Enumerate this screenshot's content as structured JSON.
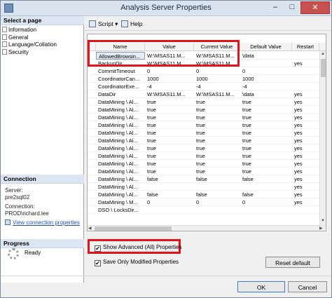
{
  "window": {
    "title": "Analysis Server Properties"
  },
  "sidebar": {
    "select_page_heading": "Select a page",
    "pages": [
      "Information",
      "General",
      "Language/Collation",
      "Security"
    ],
    "connection_heading": "Connection",
    "server_label": "Server:",
    "server_value": "pre2sql02",
    "connection_label": "Connection:",
    "connection_value": "PROD\\richard.lee",
    "view_connection_link": "View connection properties",
    "progress_heading": "Progress",
    "progress_status": "Ready"
  },
  "toolbar": {
    "script_label": "Script",
    "help_label": "Help"
  },
  "grid": {
    "headers": [
      "Name",
      "Value",
      "Current Value",
      "Default Value",
      "Restart"
    ],
    "rows": [
      [
        "AllowedBrowsin...",
        "W:\\MSAS11.M...",
        "W:\\MSAS11.M...",
        "\\data",
        ""
      ],
      [
        "BackupDir",
        "W:\\MSAS11.M...",
        "W:\\MSAS11.M...",
        "",
        "yes"
      ],
      [
        "CommitTimeout",
        "0",
        "0",
        "0",
        ""
      ],
      [
        "CoordinatorCan...",
        "1000",
        "1000",
        "1000",
        ""
      ],
      [
        "CoordinatorExe...",
        "-4",
        "-4",
        "-4",
        ""
      ],
      [
        "DataDir",
        "W:\\MSAS11.M...",
        "W:\\MSAS11.M...",
        "\\data",
        "yes"
      ],
      [
        "DataMining \\ Al...",
        "true",
        "true",
        "true",
        "yes"
      ],
      [
        "DataMining \\ Al...",
        "true",
        "true",
        "true",
        "yes"
      ],
      [
        "DataMining \\ Al...",
        "true",
        "true",
        "true",
        "yes"
      ],
      [
        "DataMining \\ Al...",
        "true",
        "true",
        "true",
        "yes"
      ],
      [
        "DataMining \\ Al...",
        "true",
        "true",
        "true",
        "yes"
      ],
      [
        "DataMining \\ Al...",
        "true",
        "true",
        "true",
        "yes"
      ],
      [
        "DataMining \\ Al...",
        "true",
        "true",
        "true",
        "yes"
      ],
      [
        "DataMining \\ Al...",
        "true",
        "true",
        "true",
        "yes"
      ],
      [
        "DataMining \\ Al...",
        "true",
        "true",
        "true",
        "yes"
      ],
      [
        "DataMining \\ Al...",
        "true",
        "true",
        "true",
        "yes"
      ],
      [
        "DataMining \\ Al...",
        "false",
        "false",
        "false",
        "yes"
      ],
      [
        "DataMining \\ Al...",
        "",
        "",
        "",
        "yes"
      ],
      [
        "DataMining \\ Al...",
        "false",
        "false",
        "false",
        "yes"
      ],
      [
        "DataMining \\ M...",
        "0",
        "0",
        "0",
        "yes"
      ],
      [
        "DSO \\ LocksDir...",
        "",
        "",
        "",
        ""
      ]
    ]
  },
  "options": {
    "show_advanced_label": "Show Advanced (All) Properties",
    "save_modified_label": "Save Only Modified Properties",
    "show_advanced_checked": true,
    "save_modified_checked": true
  },
  "buttons": {
    "reset_default": "Reset default",
    "ok": "OK",
    "cancel": "Cancel"
  },
  "colors": {
    "highlight_box": "#e1141c",
    "link": "#1e4fb0"
  }
}
